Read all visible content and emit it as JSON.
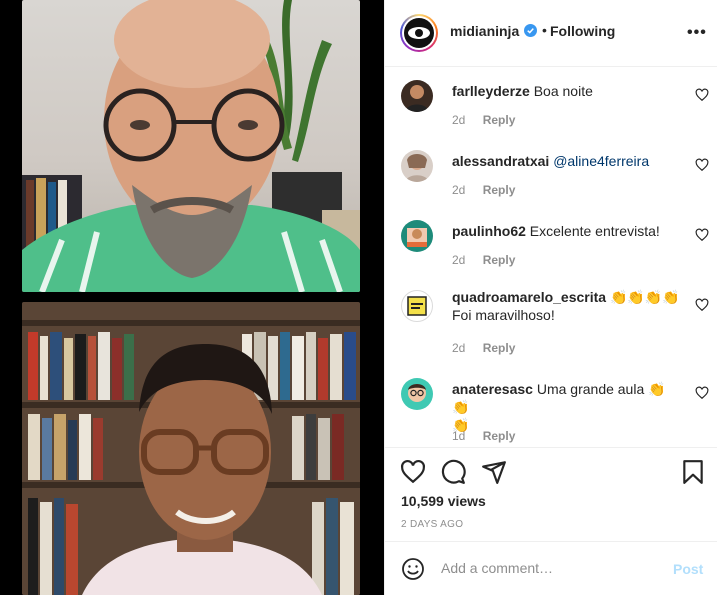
{
  "header": {
    "username": "midianinja",
    "separator": "•",
    "follow_status": "Following",
    "more_label": "•••"
  },
  "comments": [
    {
      "user": "farlleyderze",
      "text": "Boa noite",
      "mention": "",
      "age": "2d",
      "reply": "Reply"
    },
    {
      "user": "alessandratxai",
      "text": "",
      "mention": "@aline4ferreira",
      "age": "2d",
      "reply": "Reply"
    },
    {
      "user": "paulinho62",
      "text": "Excelente entrevista!",
      "mention": "",
      "age": "2d",
      "reply": "Reply"
    },
    {
      "user": "quadroamarelo_escrita",
      "text": "👏👏👏👏",
      "line2": "Foi maravilhoso!",
      "mention": "",
      "age": "2d",
      "reply": "Reply"
    },
    {
      "user": "anateresasc",
      "text": "Uma grande aula 👏👏",
      "line2": "👏",
      "mention": "",
      "age": "1d",
      "reply": "Reply"
    }
  ],
  "stats": {
    "views": "10,599 views",
    "posted": "2 DAYS AGO"
  },
  "composer": {
    "placeholder": "Add a comment…",
    "post_label": "Post"
  },
  "colors": {
    "accent": "#0095f6",
    "post_disabled": "#b2dffc",
    "muted": "#8e8e8e"
  }
}
